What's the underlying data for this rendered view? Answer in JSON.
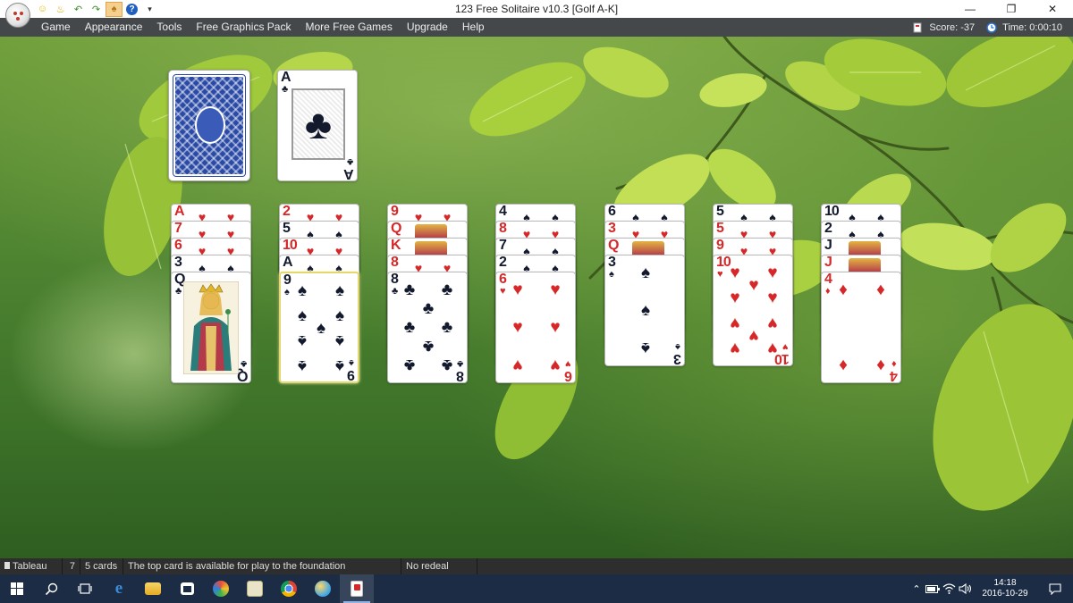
{
  "window": {
    "title": "123 Free Solitaire v10.3  [Golf A-K]",
    "controls": [
      "–",
      "❐",
      "✕"
    ]
  },
  "quick_access": [
    {
      "icon": "smiley-icon",
      "glyph": "☺"
    },
    {
      "icon": "lamp-icon",
      "glyph": "♨"
    },
    {
      "icon": "undo-arrow-icon",
      "glyph": "↶"
    },
    {
      "icon": "redo-arrow-icon",
      "glyph": "↷"
    },
    {
      "icon": "card-hint-icon",
      "glyph": "♠"
    },
    {
      "icon": "help-icon",
      "glyph": "?"
    },
    {
      "icon": "dropdown-icon",
      "glyph": "⏷"
    }
  ],
  "menu": [
    "Game",
    "Appearance",
    "Tools",
    "Free Graphics Pack",
    "More Free Games",
    "Upgrade",
    "Help"
  ],
  "stats": {
    "score_label": "Score: -37",
    "time_label": "Time: 0:00:10"
  },
  "stock": {
    "icon": "card-back-icon"
  },
  "waste": {
    "rank": "A",
    "suit": "♣",
    "color": "black"
  },
  "tableau": [
    {
      "cards": [
        {
          "rank": "A",
          "suit": "♥",
          "color": "red"
        },
        {
          "rank": "7",
          "suit": "♥",
          "color": "red"
        },
        {
          "rank": "6",
          "suit": "♥",
          "color": "red"
        },
        {
          "rank": "3",
          "suit": "♠",
          "color": "black"
        },
        {
          "rank": "Q",
          "suit": "♣",
          "color": "black",
          "face": true
        }
      ]
    },
    {
      "cards": [
        {
          "rank": "2",
          "suit": "♥",
          "color": "red"
        },
        {
          "rank": "5",
          "suit": "♠",
          "color": "black"
        },
        {
          "rank": "10",
          "suit": "♥",
          "color": "red"
        },
        {
          "rank": "A",
          "suit": "♠",
          "color": "black"
        },
        {
          "rank": "9",
          "suit": "♠",
          "color": "black",
          "highlight": true
        }
      ]
    },
    {
      "cards": [
        {
          "rank": "9",
          "suit": "♥",
          "color": "red"
        },
        {
          "rank": "Q",
          "suit": "♥",
          "color": "red",
          "face": true
        },
        {
          "rank": "K",
          "suit": "♥",
          "color": "red",
          "face": true
        },
        {
          "rank": "8",
          "suit": "♥",
          "color": "red"
        },
        {
          "rank": "8",
          "suit": "♣",
          "color": "black"
        }
      ]
    },
    {
      "cards": [
        {
          "rank": "4",
          "suit": "♠",
          "color": "black"
        },
        {
          "rank": "8",
          "suit": "♥",
          "color": "red"
        },
        {
          "rank": "7",
          "suit": "♠",
          "color": "black"
        },
        {
          "rank": "2",
          "suit": "♠",
          "color": "black"
        },
        {
          "rank": "6",
          "suit": "♥",
          "color": "red"
        }
      ]
    },
    {
      "cards": [
        {
          "rank": "6",
          "suit": "♠",
          "color": "black"
        },
        {
          "rank": "3",
          "suit": "♥",
          "color": "red"
        },
        {
          "rank": "Q",
          "suit": "♥",
          "color": "red",
          "face": true
        },
        {
          "rank": "3",
          "suit": "♠",
          "color": "black"
        }
      ]
    },
    {
      "cards": [
        {
          "rank": "5",
          "suit": "♠",
          "color": "black"
        },
        {
          "rank": "5",
          "suit": "♥",
          "color": "red"
        },
        {
          "rank": "9",
          "suit": "♥",
          "color": "red"
        },
        {
          "rank": "10",
          "suit": "♥",
          "color": "red"
        }
      ]
    },
    {
      "cards": [
        {
          "rank": "10",
          "suit": "♠",
          "color": "black"
        },
        {
          "rank": "2",
          "suit": "♠",
          "color": "black"
        },
        {
          "rank": "J",
          "suit": "♠",
          "color": "black",
          "face": true
        },
        {
          "rank": "J",
          "suit": "♥",
          "color": "red",
          "face": true
        },
        {
          "rank": "4",
          "suit": "♦",
          "color": "red"
        }
      ]
    }
  ],
  "statusbar": {
    "area": "Tableau",
    "column": "7",
    "count": "5 cards",
    "message": "The top card is available for play to the foundation",
    "redeal": "No redeal"
  },
  "taskbar": {
    "apps": [
      {
        "name": "start-button",
        "icon": "windows-icon"
      },
      {
        "name": "search-button",
        "icon": "search-icon"
      },
      {
        "name": "task-view-button",
        "icon": "task-view-icon"
      },
      {
        "name": "edge-button",
        "icon": "edge-icon"
      },
      {
        "name": "explorer-button",
        "icon": "folder-icon"
      },
      {
        "name": "store-button",
        "icon": "store-icon"
      },
      {
        "name": "app-button-1",
        "icon": "colorful-app-icon"
      },
      {
        "name": "app-button-2",
        "icon": "notepad-icon"
      },
      {
        "name": "chrome-button",
        "icon": "chrome-icon"
      },
      {
        "name": "app-button-3",
        "icon": "paint-icon"
      },
      {
        "name": "solitaire-button",
        "icon": "solitaire-icon",
        "active": true
      }
    ],
    "clock_time": "14:18",
    "clock_date": "2016-10-29"
  },
  "colors": {
    "menu_bg": "#45484b",
    "taskbar_bg": "#1b2c44",
    "card_red": "#d62828",
    "card_black": "#141a2e",
    "card_back": "#2a4aa5"
  }
}
